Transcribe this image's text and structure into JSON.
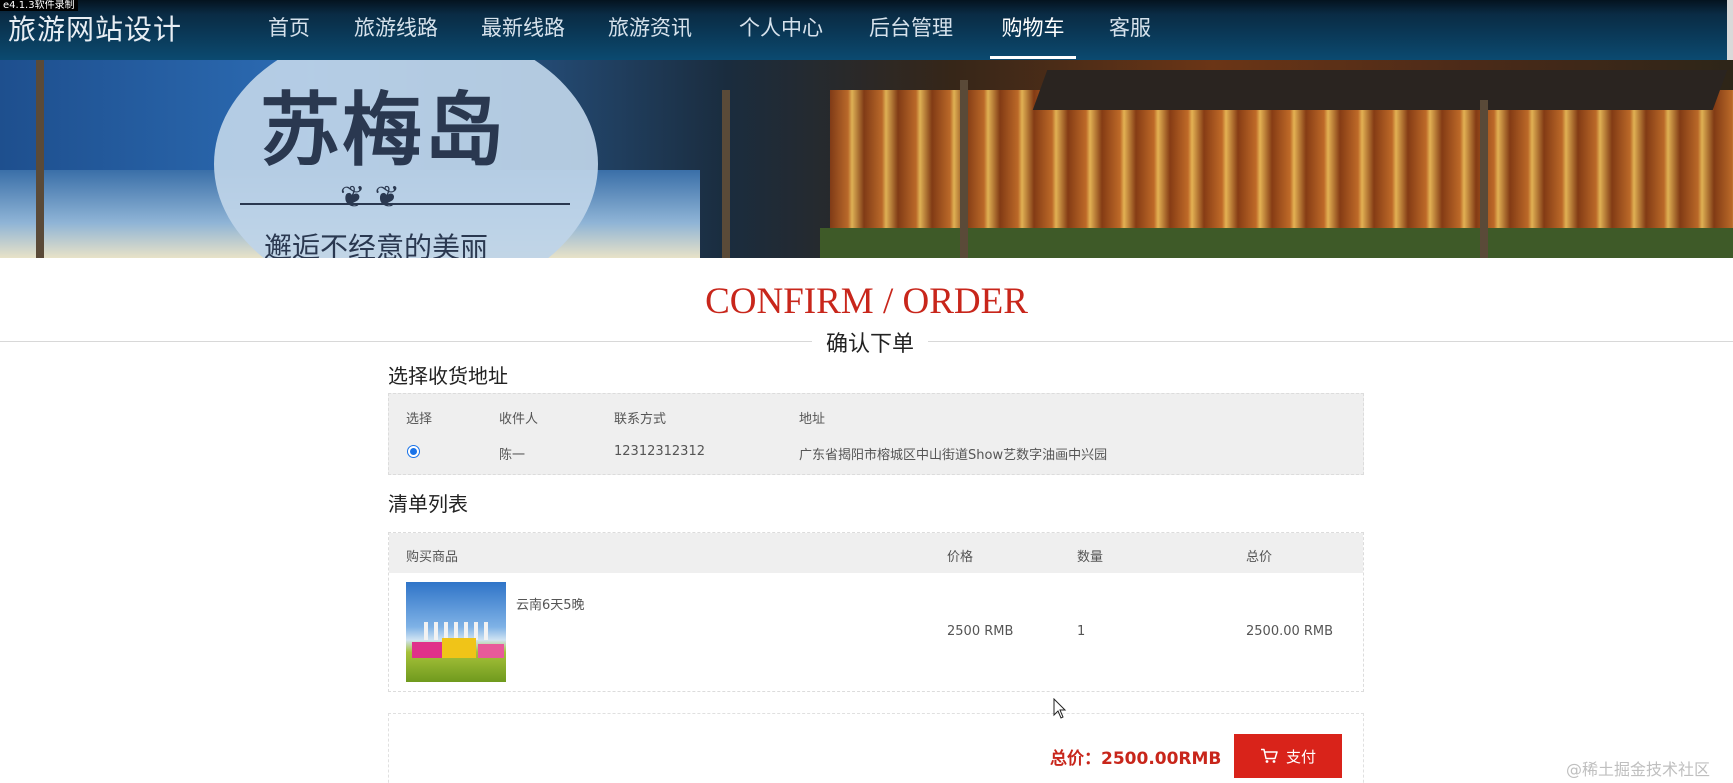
{
  "recorder_label": "e4.1.3软件录制",
  "brand": "旅游网站设计",
  "nav": {
    "items": [
      "首页",
      "旅游线路",
      "最新线路",
      "旅游资讯",
      "个人中心",
      "后台管理",
      "购物车",
      "客服"
    ],
    "active_index": 6
  },
  "banner": {
    "title": "苏梅岛",
    "subtitle": "邂逅不经意的美丽"
  },
  "heading": {
    "title_en": "CONFIRM / ORDER",
    "title_cn": "确认下单"
  },
  "address_section": {
    "heading": "选择收货地址",
    "columns": [
      "选择",
      "收件人",
      "联系方式",
      "地址"
    ],
    "rows": [
      {
        "selected": true,
        "recipient": "陈一",
        "phone": "12312312312",
        "address": "广东省揭阳市榕城区中山街道Show艺数字油画中兴园"
      }
    ]
  },
  "items_section": {
    "heading": "清单列表",
    "columns": [
      "购买商品",
      "价格",
      "数量",
      "总价"
    ],
    "rows": [
      {
        "name": "云南6天5晚",
        "price": "2500 RMB",
        "qty": "1",
        "total": "2500.00 RMB"
      }
    ]
  },
  "footer": {
    "total_label": "总价：2500.00RMB",
    "pay_label": "支付"
  },
  "watermark": "@稀土掘金技术社区",
  "colors": {
    "accent_red": "#c8261b",
    "button_red": "#d9231a",
    "nav_bg": "#0b4a70",
    "radio_blue": "#1a73e8"
  }
}
